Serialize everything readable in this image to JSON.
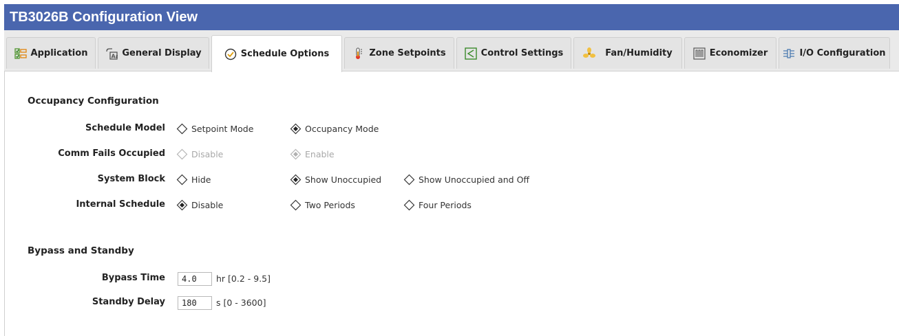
{
  "window": {
    "title": "TB3026B Configuration View"
  },
  "tabs": [
    {
      "label": "Application",
      "icon": "application-icon"
    },
    {
      "label": "General Display",
      "icon": "display-icon"
    },
    {
      "label": "Schedule Options",
      "icon": "clock-check-icon",
      "active": true
    },
    {
      "label": "Zone Setpoints",
      "icon": "thermometer-icon"
    },
    {
      "label": "Control Settings",
      "icon": "control-icon"
    },
    {
      "label": "Fan/Humidity",
      "icon": "fan-icon"
    },
    {
      "label": "Economizer",
      "icon": "economizer-icon"
    },
    {
      "label": "I/O Configuration",
      "icon": "io-icon"
    }
  ],
  "occupancy": {
    "title": "Occupancy Configuration",
    "rows": [
      {
        "label": "Schedule Model",
        "options": [
          {
            "label": "Setpoint Mode",
            "selected": false,
            "disabled": false
          },
          {
            "label": "Occupancy Mode",
            "selected": true,
            "disabled": false
          }
        ]
      },
      {
        "label": "Comm Fails Occupied",
        "options": [
          {
            "label": "Disable",
            "selected": false,
            "disabled": true
          },
          {
            "label": "Enable",
            "selected": true,
            "disabled": true
          }
        ]
      },
      {
        "label": "System Block",
        "options": [
          {
            "label": "Hide",
            "selected": false,
            "disabled": false
          },
          {
            "label": "Show Unoccupied",
            "selected": true,
            "disabled": false
          },
          {
            "label": "Show Unoccupied and Off",
            "selected": false,
            "disabled": false
          }
        ]
      },
      {
        "label": "Internal Schedule",
        "options": [
          {
            "label": "Disable",
            "selected": true,
            "disabled": false
          },
          {
            "label": "Two Periods",
            "selected": false,
            "disabled": false
          },
          {
            "label": "Four Periods",
            "selected": false,
            "disabled": false
          }
        ]
      }
    ]
  },
  "bypass": {
    "title": "Bypass and Standby",
    "bypass_time": {
      "label": "Bypass Time",
      "value": "4.0",
      "unit": "hr [0.2 - 9.5]"
    },
    "standby_delay": {
      "label": "Standby Delay",
      "value": "180",
      "unit": "s [0 - 3600]"
    }
  },
  "colors": {
    "titlebar": "#4a66ae",
    "tabbar": "#eaeaea"
  }
}
